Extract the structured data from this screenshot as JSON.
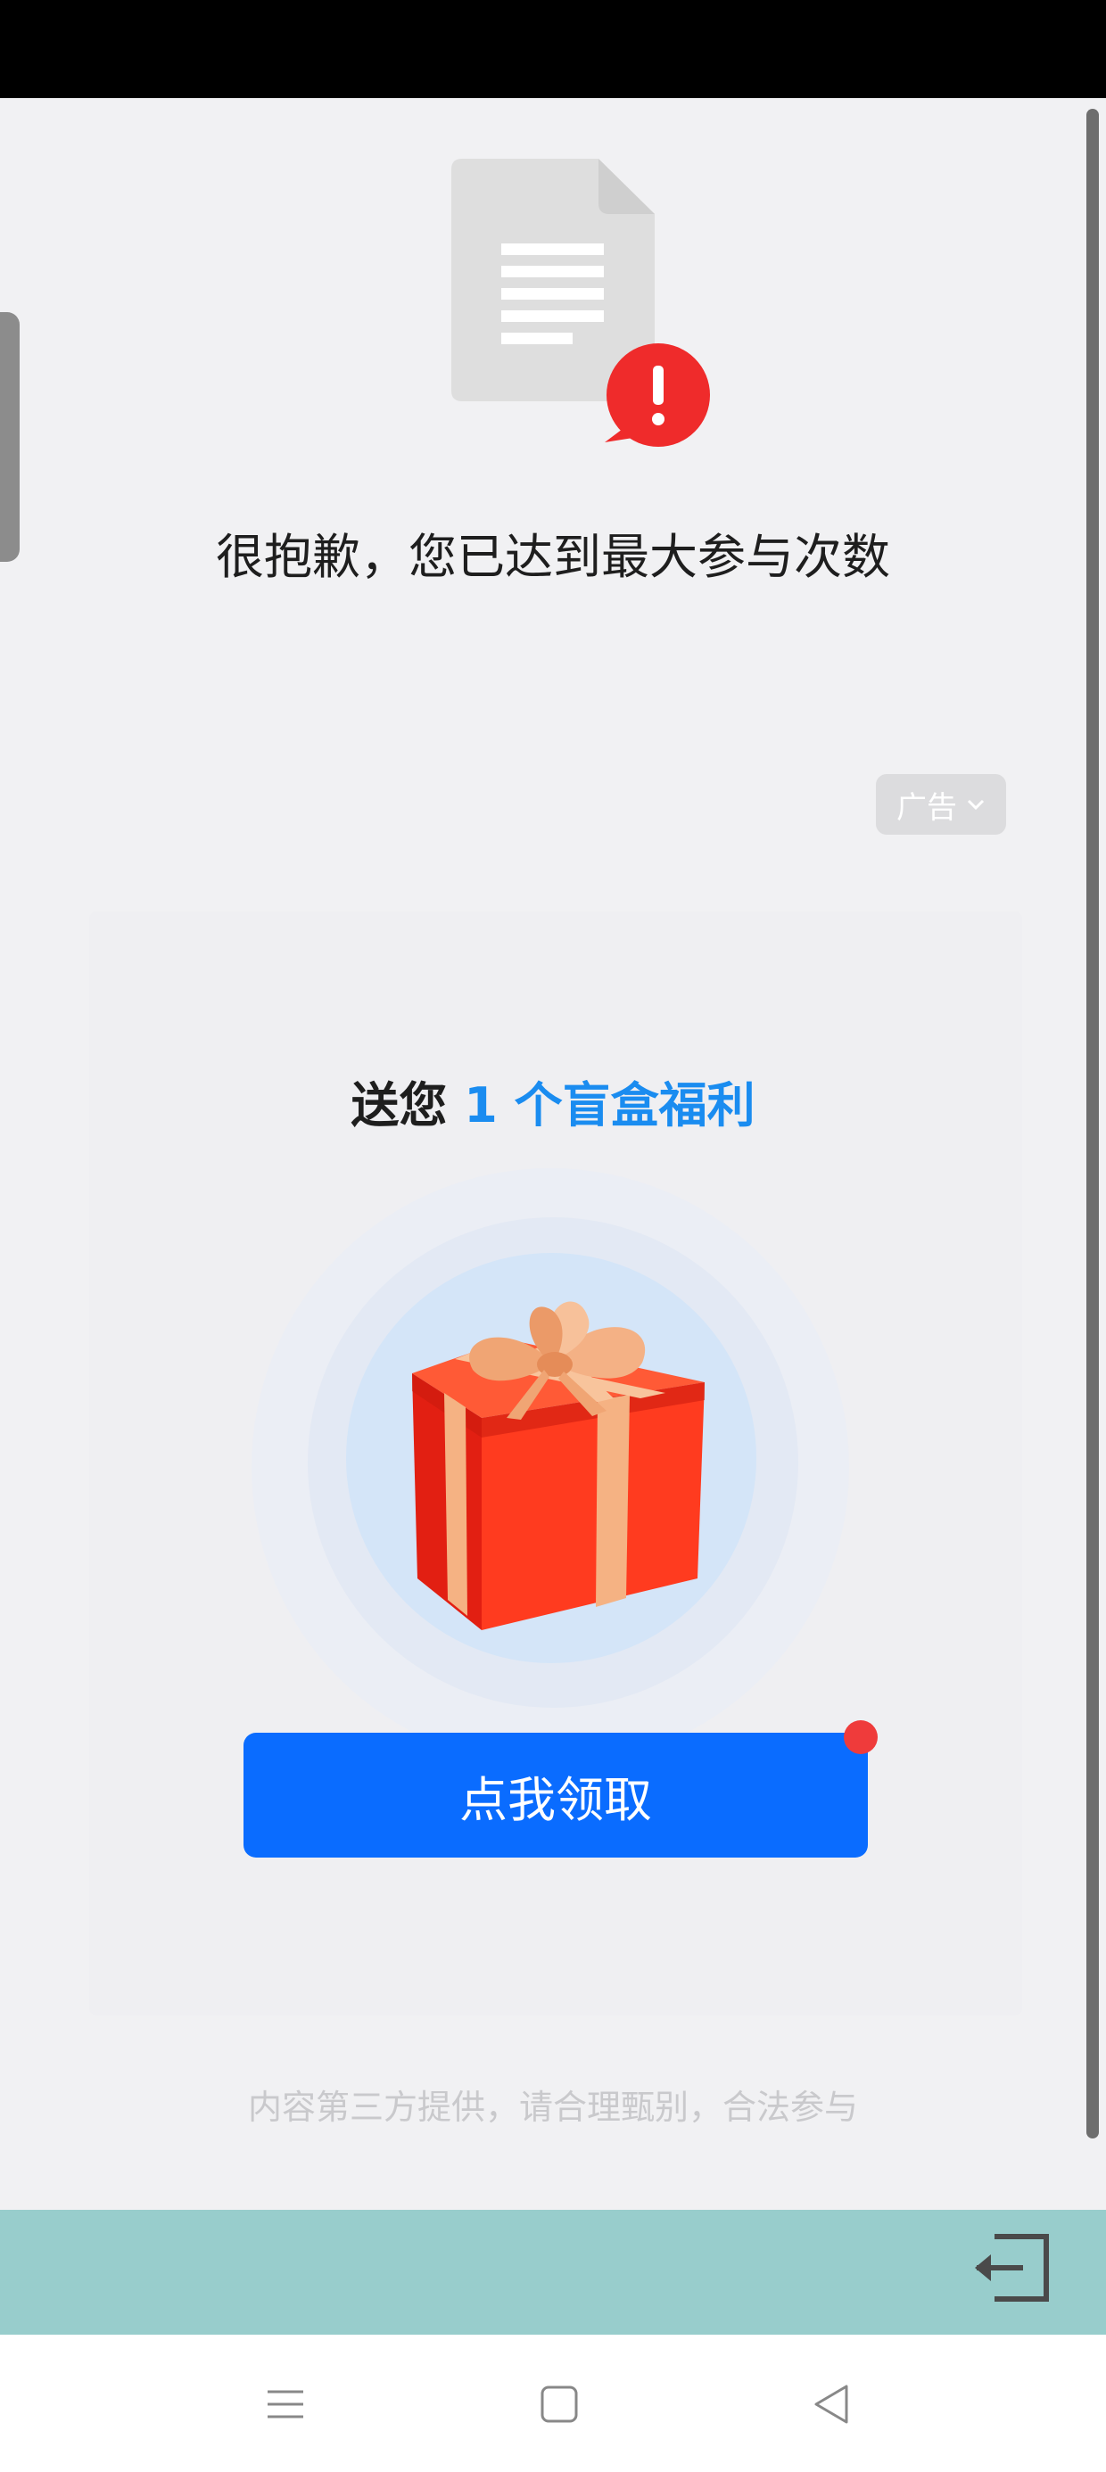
{
  "page": {
    "error_title": "很抱歉，您已达到最大参与次数",
    "ad_badge": "广告",
    "gift_title_prefix": "送您",
    "gift_title_highlight": "1 个盲盒福利",
    "claim_button": "点我领取",
    "disclaimer": "内容第三方提供，请合理甄别，合法参与"
  },
  "icons": {
    "document": "document-error-icon",
    "gift": "gift-box-icon",
    "ad_chevron": "chevron-down-icon",
    "exit": "exit-icon",
    "nav_menu": "menu-icon",
    "nav_home": "home-icon",
    "nav_back": "back-icon"
  },
  "colors": {
    "accent": "#0a6cff",
    "highlight": "#1a8cf0",
    "error": "#ef3b3b",
    "bottom_bar": "#98cdcc"
  }
}
